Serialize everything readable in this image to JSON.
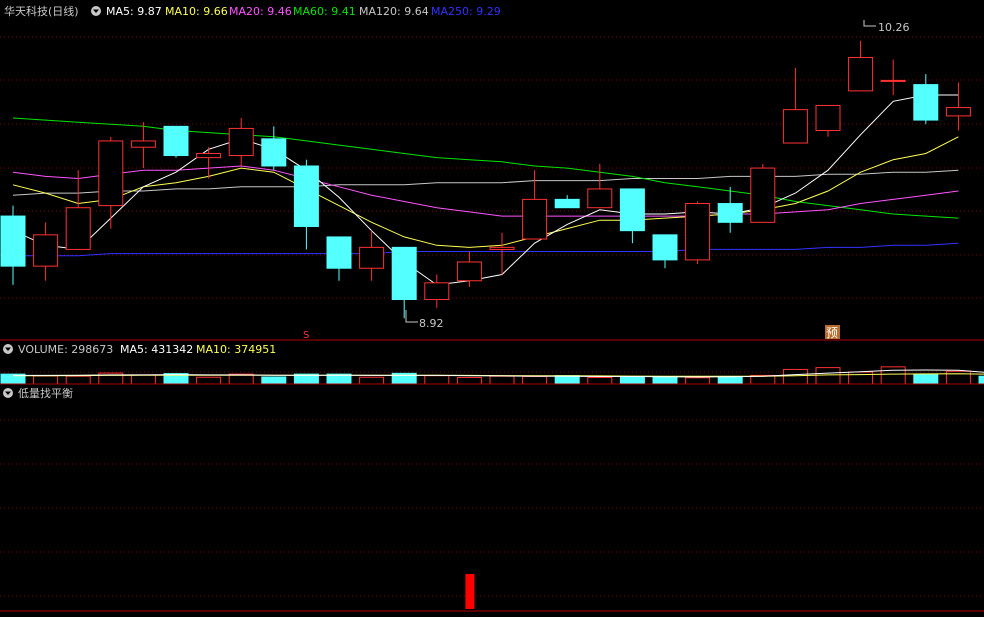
{
  "header": {
    "title": "华天科技(日线)",
    "ma5": "MA5: 9.87",
    "ma10": "MA10: 9.66",
    "ma20": "MA20: 9.46",
    "ma60": "MA60: 9.41",
    "ma120": "MA120: 9.64",
    "ma250": "MA250: 9.29"
  },
  "volume_header": {
    "label": "VOLUME: 298673",
    "ma5": "MA5: 431342",
    "ma10": "MA10: 374951"
  },
  "indicator_header": {
    "label": "低量找平衡"
  },
  "annotations": {
    "high": "10.26",
    "low": "8.92",
    "marker_s": "S",
    "marker_yu": "预"
  },
  "colors": {
    "up": "#ff3232",
    "down": "#54ffff",
    "ma5": "#ffffff",
    "ma10": "#ffff54",
    "ma20": "#ff54ff",
    "ma60": "#00e600",
    "ma120": "#c8c8c8",
    "ma250": "#3232ff",
    "grid": "#7a0000",
    "signal": "#ff0000"
  },
  "chart_data": {
    "type": "candlestick",
    "price_range": [
      8.85,
      10.35
    ],
    "candles": [
      {
        "o": 9.42,
        "h": 9.47,
        "l": 9.09,
        "c": 9.18
      },
      {
        "o": 9.18,
        "h": 9.39,
        "l": 9.11,
        "c": 9.33
      },
      {
        "o": 9.26,
        "h": 9.64,
        "l": 9.26,
        "c": 9.46
      },
      {
        "o": 9.47,
        "h": 9.8,
        "l": 9.36,
        "c": 9.78
      },
      {
        "o": 9.75,
        "h": 9.87,
        "l": 9.65,
        "c": 9.78
      },
      {
        "o": 9.85,
        "h": 9.85,
        "l": 9.7,
        "c": 9.71
      },
      {
        "o": 9.7,
        "h": 9.75,
        "l": 9.6,
        "c": 9.72
      },
      {
        "o": 9.71,
        "h": 9.89,
        "l": 9.66,
        "c": 9.84
      },
      {
        "o": 9.79,
        "h": 9.85,
        "l": 9.64,
        "c": 9.66
      },
      {
        "o": 9.66,
        "h": 9.69,
        "l": 9.26,
        "c": 9.37
      },
      {
        "o": 9.32,
        "h": 9.32,
        "l": 9.11,
        "c": 9.17
      },
      {
        "o": 9.17,
        "h": 9.35,
        "l": 9.11,
        "c": 9.27
      },
      {
        "o": 9.27,
        "h": 9.27,
        "l": 8.93,
        "c": 9.02
      },
      {
        "o": 9.02,
        "h": 9.14,
        "l": 8.98,
        "c": 9.1
      },
      {
        "o": 9.11,
        "h": 9.25,
        "l": 9.08,
        "c": 9.2
      },
      {
        "o": 9.26,
        "h": 9.34,
        "l": 9.14,
        "c": 9.27
      },
      {
        "o": 9.31,
        "h": 9.64,
        "l": 9.31,
        "c": 9.5
      },
      {
        "o": 9.5,
        "h": 9.52,
        "l": 9.46,
        "c": 9.46
      },
      {
        "o": 9.46,
        "h": 9.67,
        "l": 9.46,
        "c": 9.55
      },
      {
        "o": 9.55,
        "h": 9.55,
        "l": 9.29,
        "c": 9.35
      },
      {
        "o": 9.33,
        "h": 9.33,
        "l": 9.17,
        "c": 9.21
      },
      {
        "o": 9.21,
        "h": 9.49,
        "l": 9.19,
        "c": 9.48
      },
      {
        "o": 9.48,
        "h": 9.56,
        "l": 9.34,
        "c": 9.39
      },
      {
        "o": 9.39,
        "h": 9.67,
        "l": 9.39,
        "c": 9.65
      },
      {
        "o": 9.77,
        "h": 10.13,
        "l": 9.77,
        "c": 9.93
      },
      {
        "o": 9.83,
        "h": 9.95,
        "l": 9.8,
        "c": 9.95
      },
      {
        "o": 10.02,
        "h": 10.26,
        "l": 10.02,
        "c": 10.18
      },
      {
        "o": 10.07,
        "h": 10.17,
        "l": 10.0,
        "c": 10.07
      },
      {
        "o": 10.05,
        "h": 10.1,
        "l": 9.86,
        "c": 9.88
      },
      {
        "o": 9.9,
        "h": 10.06,
        "l": 9.83,
        "c": 9.94
      }
    ],
    "ma5": [
      9.35,
      9.28,
      9.26,
      9.41,
      9.56,
      9.63,
      9.74,
      9.79,
      9.74,
      9.64,
      9.51,
      9.35,
      9.2,
      9.09,
      9.11,
      9.14,
      9.29,
      9.38,
      9.45,
      9.43,
      9.43,
      9.44,
      9.43,
      9.46,
      9.53,
      9.64,
      9.81,
      9.97,
      10.0,
      10.0
    ],
    "ma10": [
      9.57,
      9.53,
      9.48,
      9.5,
      9.56,
      9.58,
      9.61,
      9.65,
      9.63,
      9.55,
      9.47,
      9.39,
      9.32,
      9.28,
      9.27,
      9.28,
      9.32,
      9.36,
      9.4,
      9.4,
      9.41,
      9.42,
      9.43,
      9.45,
      9.48,
      9.54,
      9.63,
      9.69,
      9.72,
      9.8
    ],
    "ma20": [
      9.63,
      9.61,
      9.6,
      9.62,
      9.64,
      9.64,
      9.65,
      9.66,
      9.64,
      9.6,
      9.56,
      9.52,
      9.49,
      9.46,
      9.44,
      9.42,
      9.42,
      9.42,
      9.42,
      9.42,
      9.42,
      9.42,
      9.43,
      9.43,
      9.44,
      9.45,
      9.48,
      9.5,
      9.52,
      9.54
    ],
    "ma60": [
      9.89,
      9.88,
      9.87,
      9.86,
      9.85,
      9.83,
      9.82,
      9.81,
      9.8,
      9.78,
      9.76,
      9.74,
      9.72,
      9.7,
      9.69,
      9.68,
      9.66,
      9.65,
      9.63,
      9.61,
      9.58,
      9.56,
      9.54,
      9.52,
      9.49,
      9.47,
      9.45,
      9.43,
      9.42,
      9.41
    ],
    "ma120": [
      9.52,
      9.53,
      9.53,
      9.54,
      9.54,
      9.55,
      9.55,
      9.56,
      9.56,
      9.56,
      9.57,
      9.57,
      9.57,
      9.58,
      9.58,
      9.58,
      9.59,
      9.59,
      9.59,
      9.6,
      9.6,
      9.6,
      9.61,
      9.61,
      9.61,
      9.62,
      9.62,
      9.63,
      9.63,
      9.64
    ],
    "ma250": [
      9.23,
      9.23,
      9.23,
      9.24,
      9.24,
      9.24,
      9.24,
      9.24,
      9.24,
      9.24,
      9.24,
      9.24,
      9.25,
      9.25,
      9.25,
      9.25,
      9.25,
      9.25,
      9.25,
      9.25,
      9.25,
      9.26,
      9.26,
      9.26,
      9.26,
      9.27,
      9.27,
      9.28,
      9.28,
      9.29
    ],
    "volume": [
      380000,
      310000,
      300000,
      420000,
      350000,
      400000,
      260000,
      380000,
      270000,
      380000,
      380000,
      260000,
      410000,
      320000,
      250000,
      300000,
      290000,
      320000,
      250000,
      260000,
      260000,
      240000,
      290000,
      330000,
      560000,
      630000,
      460000,
      660000,
      380000,
      490000,
      298673
    ],
    "volume_ma5": [
      330000,
      330000,
      340000,
      350000,
      350000,
      360000,
      350000,
      350000,
      340000,
      330000,
      340000,
      330000,
      330000,
      330000,
      320000,
      310000,
      300000,
      300000,
      290000,
      290000,
      280000,
      270000,
      280000,
      300000,
      360000,
      420000,
      470000,
      530000,
      540000,
      530000,
      431342
    ],
    "volume_ma10": [
      320000,
      320000,
      325000,
      330000,
      335000,
      340000,
      340000,
      340000,
      340000,
      340000,
      340000,
      340000,
      340000,
      335000,
      330000,
      325000,
      320000,
      315000,
      310000,
      305000,
      300000,
      295000,
      295000,
      300000,
      320000,
      350000,
      360000,
      380000,
      390000,
      395000,
      374951
    ],
    "volume_range": [
      0,
      1000000
    ],
    "indicator_bars": [
      {
        "index": 14,
        "value": 1
      }
    ]
  }
}
